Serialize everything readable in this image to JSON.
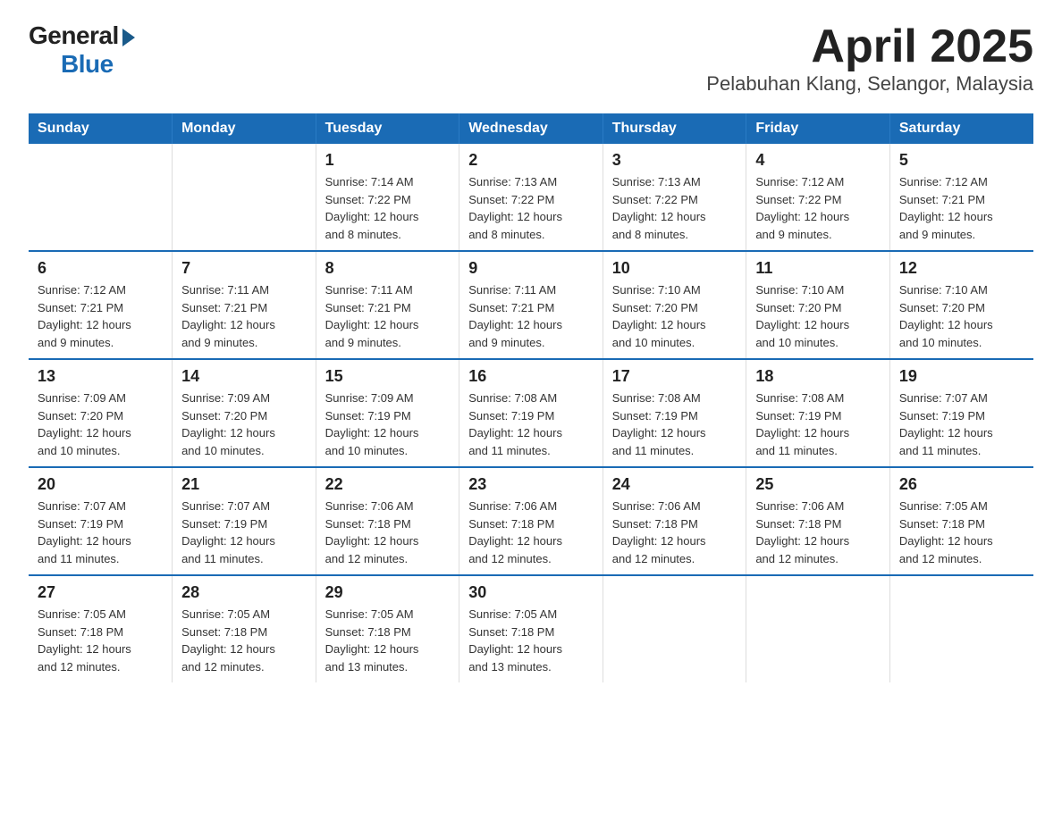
{
  "logo": {
    "general": "General",
    "blue": "Blue"
  },
  "title": "April 2025",
  "subtitle": "Pelabuhan Klang, Selangor, Malaysia",
  "headers": [
    "Sunday",
    "Monday",
    "Tuesday",
    "Wednesday",
    "Thursday",
    "Friday",
    "Saturday"
  ],
  "weeks": [
    [
      {
        "day": "",
        "info": ""
      },
      {
        "day": "",
        "info": ""
      },
      {
        "day": "1",
        "info": "Sunrise: 7:14 AM\nSunset: 7:22 PM\nDaylight: 12 hours\nand 8 minutes."
      },
      {
        "day": "2",
        "info": "Sunrise: 7:13 AM\nSunset: 7:22 PM\nDaylight: 12 hours\nand 8 minutes."
      },
      {
        "day": "3",
        "info": "Sunrise: 7:13 AM\nSunset: 7:22 PM\nDaylight: 12 hours\nand 8 minutes."
      },
      {
        "day": "4",
        "info": "Sunrise: 7:12 AM\nSunset: 7:22 PM\nDaylight: 12 hours\nand 9 minutes."
      },
      {
        "day": "5",
        "info": "Sunrise: 7:12 AM\nSunset: 7:21 PM\nDaylight: 12 hours\nand 9 minutes."
      }
    ],
    [
      {
        "day": "6",
        "info": "Sunrise: 7:12 AM\nSunset: 7:21 PM\nDaylight: 12 hours\nand 9 minutes."
      },
      {
        "day": "7",
        "info": "Sunrise: 7:11 AM\nSunset: 7:21 PM\nDaylight: 12 hours\nand 9 minutes."
      },
      {
        "day": "8",
        "info": "Sunrise: 7:11 AM\nSunset: 7:21 PM\nDaylight: 12 hours\nand 9 minutes."
      },
      {
        "day": "9",
        "info": "Sunrise: 7:11 AM\nSunset: 7:21 PM\nDaylight: 12 hours\nand 9 minutes."
      },
      {
        "day": "10",
        "info": "Sunrise: 7:10 AM\nSunset: 7:20 PM\nDaylight: 12 hours\nand 10 minutes."
      },
      {
        "day": "11",
        "info": "Sunrise: 7:10 AM\nSunset: 7:20 PM\nDaylight: 12 hours\nand 10 minutes."
      },
      {
        "day": "12",
        "info": "Sunrise: 7:10 AM\nSunset: 7:20 PM\nDaylight: 12 hours\nand 10 minutes."
      }
    ],
    [
      {
        "day": "13",
        "info": "Sunrise: 7:09 AM\nSunset: 7:20 PM\nDaylight: 12 hours\nand 10 minutes."
      },
      {
        "day": "14",
        "info": "Sunrise: 7:09 AM\nSunset: 7:20 PM\nDaylight: 12 hours\nand 10 minutes."
      },
      {
        "day": "15",
        "info": "Sunrise: 7:09 AM\nSunset: 7:19 PM\nDaylight: 12 hours\nand 10 minutes."
      },
      {
        "day": "16",
        "info": "Sunrise: 7:08 AM\nSunset: 7:19 PM\nDaylight: 12 hours\nand 11 minutes."
      },
      {
        "day": "17",
        "info": "Sunrise: 7:08 AM\nSunset: 7:19 PM\nDaylight: 12 hours\nand 11 minutes."
      },
      {
        "day": "18",
        "info": "Sunrise: 7:08 AM\nSunset: 7:19 PM\nDaylight: 12 hours\nand 11 minutes."
      },
      {
        "day": "19",
        "info": "Sunrise: 7:07 AM\nSunset: 7:19 PM\nDaylight: 12 hours\nand 11 minutes."
      }
    ],
    [
      {
        "day": "20",
        "info": "Sunrise: 7:07 AM\nSunset: 7:19 PM\nDaylight: 12 hours\nand 11 minutes."
      },
      {
        "day": "21",
        "info": "Sunrise: 7:07 AM\nSunset: 7:19 PM\nDaylight: 12 hours\nand 11 minutes."
      },
      {
        "day": "22",
        "info": "Sunrise: 7:06 AM\nSunset: 7:18 PM\nDaylight: 12 hours\nand 12 minutes."
      },
      {
        "day": "23",
        "info": "Sunrise: 7:06 AM\nSunset: 7:18 PM\nDaylight: 12 hours\nand 12 minutes."
      },
      {
        "day": "24",
        "info": "Sunrise: 7:06 AM\nSunset: 7:18 PM\nDaylight: 12 hours\nand 12 minutes."
      },
      {
        "day": "25",
        "info": "Sunrise: 7:06 AM\nSunset: 7:18 PM\nDaylight: 12 hours\nand 12 minutes."
      },
      {
        "day": "26",
        "info": "Sunrise: 7:05 AM\nSunset: 7:18 PM\nDaylight: 12 hours\nand 12 minutes."
      }
    ],
    [
      {
        "day": "27",
        "info": "Sunrise: 7:05 AM\nSunset: 7:18 PM\nDaylight: 12 hours\nand 12 minutes."
      },
      {
        "day": "28",
        "info": "Sunrise: 7:05 AM\nSunset: 7:18 PM\nDaylight: 12 hours\nand 12 minutes."
      },
      {
        "day": "29",
        "info": "Sunrise: 7:05 AM\nSunset: 7:18 PM\nDaylight: 12 hours\nand 13 minutes."
      },
      {
        "day": "30",
        "info": "Sunrise: 7:05 AM\nSunset: 7:18 PM\nDaylight: 12 hours\nand 13 minutes."
      },
      {
        "day": "",
        "info": ""
      },
      {
        "day": "",
        "info": ""
      },
      {
        "day": "",
        "info": ""
      }
    ]
  ]
}
